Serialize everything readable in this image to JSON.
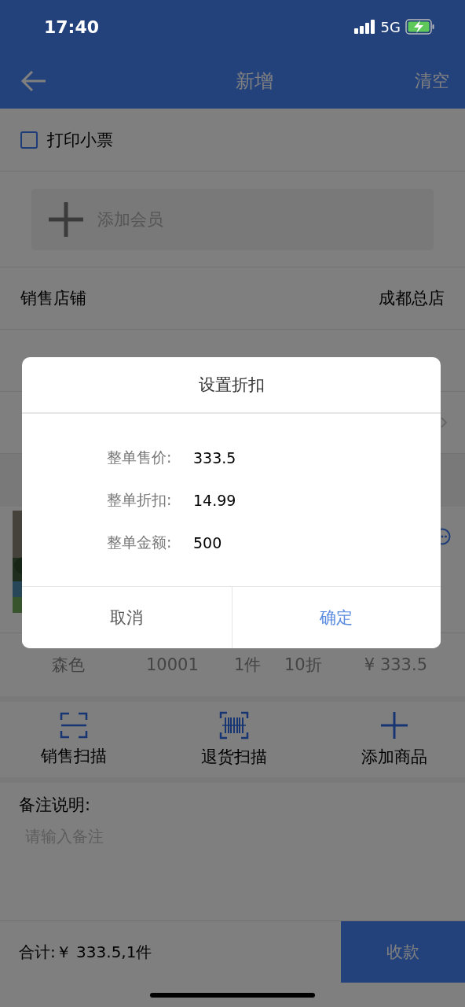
{
  "status_bar": {
    "time": "17:40",
    "network": "5G"
  },
  "nav": {
    "title": "新增",
    "action": "清空"
  },
  "print_receipt": {
    "label": "打印小票",
    "checked": false
  },
  "member": {
    "label": "添加会员"
  },
  "rows": [
    {
      "label": "销售店铺",
      "value": "成都总店"
    }
  ],
  "product": {
    "specs": [
      "森色",
      "10001",
      "1件",
      "10折",
      "¥ 333.5"
    ]
  },
  "actions": [
    {
      "kind": "scan",
      "label": "销售扫描"
    },
    {
      "kind": "barcode",
      "label": "退货扫描"
    },
    {
      "kind": "plus",
      "label": "添加商品"
    }
  ],
  "remarks": {
    "label": "备注说明:",
    "placeholder": "请输入备注"
  },
  "footer": {
    "total": "合计:￥ 333.5,1件",
    "button": "收款"
  },
  "dialog": {
    "title": "设置折扣",
    "fields": [
      {
        "label": "整单售价:",
        "value": "333.5"
      },
      {
        "label": "整单折扣:",
        "value": "14.99"
      },
      {
        "label": "整单金额:",
        "value": "500"
      }
    ],
    "buttons": [
      {
        "kind": "cancel",
        "label": "取消"
      },
      {
        "kind": "confirm",
        "label": "确定"
      }
    ]
  }
}
